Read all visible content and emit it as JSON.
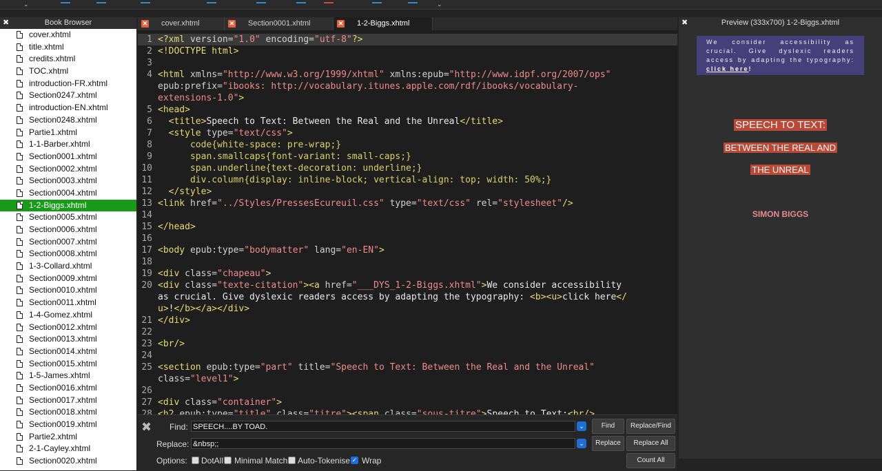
{
  "book_browser": {
    "title": "Book Browser",
    "files": [
      "cover.xhtml",
      "title.xhtml",
      "credits.xhtml",
      "TOC.xhtml",
      "introduction-FR.xhtml",
      "Section0247.xhtml",
      "introduction-EN.xhtml",
      "Section0248.xhtml",
      "Partie1.xhtml",
      "1-1-Barber.xhtml",
      "Section0001.xhtml",
      "Section0002.xhtml",
      "Section0003.xhtml",
      "Section0004.xhtml",
      "1-2-Biggs.xhtml",
      "Section0005.xhtml",
      "Section0006.xhtml",
      "Section0007.xhtml",
      "Section0008.xhtml",
      "1-3-Collard.xhtml",
      "Section0009.xhtml",
      "Section0010.xhtml",
      "Section0011.xhtml",
      "1-4-Gomez.xhtml",
      "Section0012.xhtml",
      "Section0013.xhtml",
      "Section0014.xhtml",
      "Section0015.xhtml",
      "1-5-James.xhtml",
      "Section0016.xhtml",
      "Section0017.xhtml",
      "Section0018.xhtml",
      "Section0019.xhtml",
      "Partie2.xhtml",
      "2-1-Cayley.xhtml",
      "Section0020.xhtml"
    ],
    "selected": "1-2-Biggs.xhtml",
    "selected_color": "#1a9a1a"
  },
  "tabs": [
    {
      "label": "cover.xhtml"
    },
    {
      "label": "Section0001.xhtml"
    },
    {
      "label": "1-2-Biggs.xhtml",
      "active": true
    }
  ],
  "editor": {
    "lines": [
      {
        "n": "1",
        "current": true,
        "segs": [
          [
            "tg",
            "<?xml "
          ],
          [
            "at",
            "version="
          ],
          [
            "st",
            "\"1.0\""
          ],
          [
            "at",
            " encoding="
          ],
          [
            "st",
            "\"utf-8\""
          ],
          [
            "tg",
            "?>"
          ]
        ]
      },
      {
        "n": "2",
        "segs": [
          [
            "tg",
            "<!DOCTYPE html>"
          ]
        ]
      },
      {
        "n": "3",
        "segs": []
      },
      {
        "n": "4",
        "segs": [
          [
            "tg",
            "<html "
          ],
          [
            "at",
            "xmlns="
          ],
          [
            "st",
            "\"http://www.w3.org/1999/xhtml\""
          ],
          [
            "at",
            " xmlns:epub="
          ],
          [
            "st",
            "\"http://www.idpf.org/2007/ops\""
          ]
        ]
      },
      {
        "n": "",
        "segs": [
          [
            "at",
            "epub:prefix="
          ],
          [
            "st",
            "\"ibooks: http://vocabulary.itunes.apple.com/rdf/ibooks/vocabulary-"
          ]
        ]
      },
      {
        "n": "",
        "segs": [
          [
            "st",
            "extensions-1.0\""
          ],
          [
            "tg",
            ">"
          ]
        ]
      },
      {
        "n": "5",
        "segs": [
          [
            "tg",
            "<head>"
          ]
        ]
      },
      {
        "n": "6",
        "segs": [
          [
            "tg",
            "  <title>"
          ],
          [
            "tx",
            "Speech to Text: Between the Real and the Unreal"
          ],
          [
            "tg",
            "</title>"
          ]
        ]
      },
      {
        "n": "7",
        "segs": [
          [
            "tg",
            "  <style "
          ],
          [
            "at",
            "type="
          ],
          [
            "st",
            "\"text/css\""
          ],
          [
            "tg",
            ">"
          ]
        ]
      },
      {
        "n": "8",
        "segs": [
          [
            "cs",
            "      code{white-space: pre-wrap;}"
          ]
        ]
      },
      {
        "n": "9",
        "segs": [
          [
            "cs",
            "      span.smallcaps{font-variant: small-caps;}"
          ]
        ]
      },
      {
        "n": "10",
        "segs": [
          [
            "cs",
            "      span.underline{text-decoration: underline;}"
          ]
        ]
      },
      {
        "n": "11",
        "segs": [
          [
            "cs",
            "      div.column{display: inline-block; vertical-align: top; width: 50%;}"
          ]
        ]
      },
      {
        "n": "12",
        "segs": [
          [
            "tg",
            "  </style>"
          ]
        ]
      },
      {
        "n": "13",
        "segs": [
          [
            "tg",
            "<link "
          ],
          [
            "at",
            "href="
          ],
          [
            "st",
            "\"../Styles/PressesEcureuil.css\""
          ],
          [
            "at",
            " type="
          ],
          [
            "st",
            "\"text/css\""
          ],
          [
            "at",
            " rel="
          ],
          [
            "st",
            "\"stylesheet\""
          ],
          [
            "tg",
            "/>"
          ]
        ]
      },
      {
        "n": "14",
        "segs": []
      },
      {
        "n": "15",
        "segs": [
          [
            "tg",
            "</head>"
          ]
        ]
      },
      {
        "n": "16",
        "segs": []
      },
      {
        "n": "17",
        "segs": [
          [
            "tg",
            "<body "
          ],
          [
            "at",
            "epub:type="
          ],
          [
            "st",
            "\"bodymatter\""
          ],
          [
            "at",
            " lang="
          ],
          [
            "st",
            "\"en-EN\""
          ],
          [
            "tg",
            ">"
          ]
        ]
      },
      {
        "n": "18",
        "segs": []
      },
      {
        "n": "19",
        "segs": [
          [
            "tg",
            "<div "
          ],
          [
            "at",
            "class="
          ],
          [
            "st",
            "\"chapeau\""
          ],
          [
            "tg",
            ">"
          ]
        ]
      },
      {
        "n": "20",
        "segs": [
          [
            "tg",
            "<div "
          ],
          [
            "at",
            "class="
          ],
          [
            "st",
            "\"texte-citation\""
          ],
          [
            "tg",
            "><a "
          ],
          [
            "at",
            "href="
          ],
          [
            "st",
            "\"___DYS_1-2-Biggs.xhtml\""
          ],
          [
            "tg",
            ">"
          ],
          [
            "tx",
            "We consider accessibility"
          ]
        ]
      },
      {
        "n": "",
        "segs": [
          [
            "tx",
            "as crucial. Give dyslexic readers access by adapting the typography: "
          ],
          [
            "tg",
            "<b><u>"
          ],
          [
            "tx",
            "click here"
          ],
          [
            "tg",
            "</"
          ]
        ]
      },
      {
        "n": "",
        "segs": [
          [
            "tg",
            "u>"
          ],
          [
            "tx",
            "!"
          ],
          [
            "tg",
            "</b></a></div>"
          ]
        ]
      },
      {
        "n": "21",
        "segs": [
          [
            "tg",
            "</div>"
          ]
        ]
      },
      {
        "n": "22",
        "segs": []
      },
      {
        "n": "23",
        "segs": [
          [
            "tg",
            "<br/>"
          ]
        ]
      },
      {
        "n": "24",
        "segs": []
      },
      {
        "n": "25",
        "segs": [
          [
            "tg",
            "<section "
          ],
          [
            "at",
            "epub:type="
          ],
          [
            "st",
            "\"part\""
          ],
          [
            "at",
            " title="
          ],
          [
            "st",
            "\"Speech to Text: Between the Real and the Unreal\""
          ]
        ]
      },
      {
        "n": "",
        "segs": [
          [
            "at",
            "class="
          ],
          [
            "st",
            "\"level1\""
          ],
          [
            "tg",
            ">"
          ]
        ]
      },
      {
        "n": "26",
        "segs": []
      },
      {
        "n": "27",
        "segs": [
          [
            "tg",
            "<div "
          ],
          [
            "at",
            "class="
          ],
          [
            "st",
            "\"container\""
          ],
          [
            "tg",
            ">"
          ]
        ]
      },
      {
        "n": "28",
        "segs": [
          [
            "tg",
            "<h2 "
          ],
          [
            "at",
            "epub:type="
          ],
          [
            "st",
            "\"title\""
          ],
          [
            "at",
            " class="
          ],
          [
            "st",
            "\"titre\""
          ],
          [
            "tg",
            "><span "
          ],
          [
            "at",
            "class="
          ],
          [
            "st",
            "\"sous-titre\""
          ],
          [
            "tg",
            ">"
          ],
          [
            "tx",
            "Speech to Text:"
          ],
          [
            "tg",
            "<br/>"
          ]
        ]
      }
    ]
  },
  "find_replace": {
    "find_label": "Find:",
    "find_value": "SPEECH....BY TOAD.",
    "replace_label": "Replace:",
    "replace_value": "&nbsp;;",
    "options_label": "Options:",
    "options": [
      {
        "label": "DotAll",
        "checked": false
      },
      {
        "label": "Minimal Match",
        "checked": false
      },
      {
        "label": "Auto-Tokenise",
        "checked": false
      },
      {
        "label": "Wrap",
        "checked": true
      }
    ],
    "buttons": {
      "find": "Find",
      "replace_find": "Replace/Find",
      "replace": "Replace",
      "replace_all": "Replace All",
      "count_all": "Count All"
    }
  },
  "preview": {
    "title": "Preview (333x700) 1-2-Biggs.xhtml",
    "accessibility_text": "We consider accessibility as crucial. Give dyslexic readers access by adapting the typography: ",
    "accessibility_link": "click here",
    "accessibility_end": "!",
    "title_line1": "SPEECH TO TEXT:",
    "title_line2": "BETWEEN THE REAL AND",
    "title_line3": "THE UNREAL",
    "author": "SIMON BIGGS",
    "box_color": "#473f7a",
    "highlight_color": "#b94a38"
  }
}
